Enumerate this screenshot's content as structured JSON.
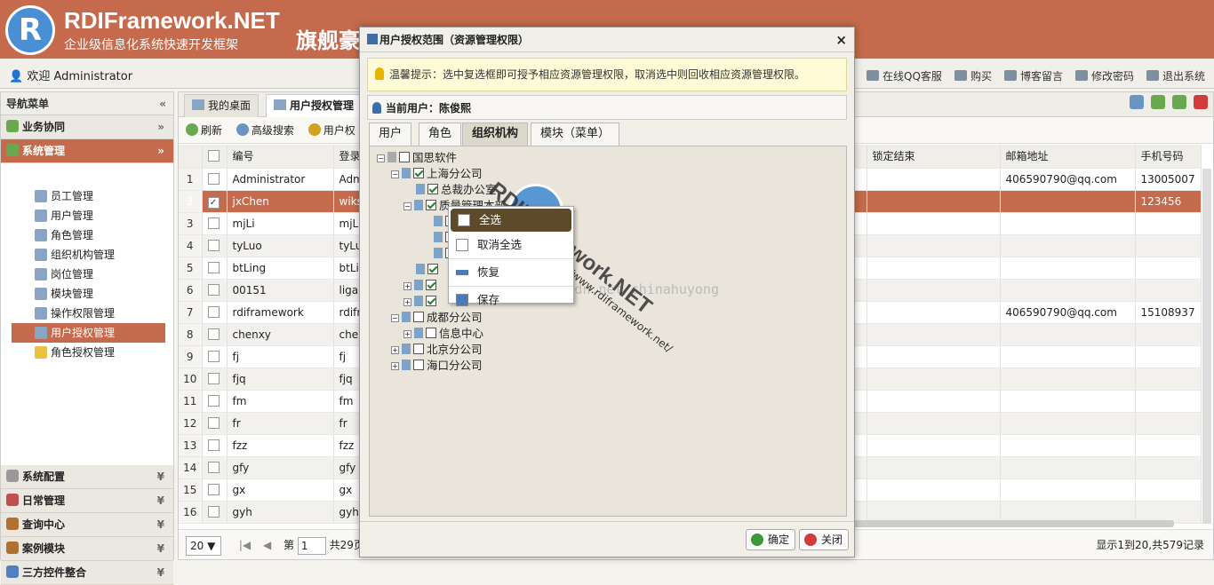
{
  "header": {
    "logo_letter": "R",
    "title": "RDIFramework.NET",
    "subtitle": "企业级信息化系统快速开发框架",
    "edition": "旗舰豪华版"
  },
  "userbar": {
    "welcome": "欢迎 Administrator",
    "links": [
      "在线QQ客服",
      "购买",
      "博客留言",
      "修改密码",
      "退出系统"
    ]
  },
  "nav": {
    "title": "导航菜单",
    "groups": [
      "业务协同",
      "系统管理",
      "系统配置",
      "日常管理",
      "查询中心",
      "案例模块",
      "三方控件整合"
    ],
    "items": [
      "员工管理",
      "用户管理",
      "角色管理",
      "组织机构管理",
      "岗位管理",
      "模块管理",
      "操作权限管理",
      "用户授权管理",
      "角色授权管理"
    ]
  },
  "tabs": [
    "我的桌面",
    "用户授权管理"
  ],
  "toolbar": [
    "刷新",
    "高级搜索",
    "用户权"
  ],
  "grid": {
    "headers": [
      "编号",
      "登录",
      "锁定结束",
      "邮箱地址",
      "手机号码"
    ],
    "rows": [
      {
        "n": "1",
        "code": "Administrator",
        "login": "Adm",
        "lock": "",
        "mail": "406590790@qq.com",
        "phone": "13005007"
      },
      {
        "n": "2",
        "code": "jxChen",
        "login": "wiks",
        "lock": "",
        "mail": "",
        "phone": "123456"
      },
      {
        "n": "3",
        "code": "mjLi",
        "login": "mjLi",
        "lock": "",
        "mail": "",
        "phone": ""
      },
      {
        "n": "4",
        "code": "tyLuo",
        "login": "tyLu",
        "lock": "",
        "mail": "",
        "phone": ""
      },
      {
        "n": "5",
        "code": "btLing",
        "login": "btLi",
        "lock": "",
        "mail": "",
        "phone": ""
      },
      {
        "n": "6",
        "code": "00151",
        "login": "liga",
        "lock": "",
        "mail": "",
        "phone": ""
      },
      {
        "n": "7",
        "code": "rdiframework",
        "login": "rdifr",
        "lock": "",
        "mail": "406590790@qq.com",
        "phone": "15108937"
      },
      {
        "n": "8",
        "code": "chenxy",
        "login": "che",
        "lock": "",
        "mail": "",
        "phone": ""
      },
      {
        "n": "9",
        "code": "fj",
        "login": "fj",
        "lock": "",
        "mail": "",
        "phone": ""
      },
      {
        "n": "10",
        "code": "fjq",
        "login": "fjq",
        "lock": "",
        "mail": "",
        "phone": ""
      },
      {
        "n": "11",
        "code": "fm",
        "login": "fm",
        "lock": "",
        "mail": "",
        "phone": ""
      },
      {
        "n": "12",
        "code": "fr",
        "login": "fr",
        "lock": "",
        "mail": "",
        "phone": ""
      },
      {
        "n": "13",
        "code": "fzz",
        "login": "fzz",
        "lock": "",
        "mail": "",
        "phone": ""
      },
      {
        "n": "14",
        "code": "gfy",
        "login": "gfy",
        "lock": "",
        "mail": "",
        "phone": ""
      },
      {
        "n": "15",
        "code": "gx",
        "login": "gx",
        "lock": "",
        "mail": "",
        "phone": ""
      },
      {
        "n": "16",
        "code": "gyh",
        "login": "gyh",
        "lock": "",
        "mail": "",
        "phone": ""
      }
    ]
  },
  "pager": {
    "page_size": "20 ▼",
    "page_label": "第",
    "page": "1",
    "total_pages": "共29页",
    "info": "显示1到20,共579记录"
  },
  "dialog": {
    "title": "用户授权范围（资源管理权限）",
    "tip": "温馨提示：选中复选框即可授予相应资源管理权限，取消选中则回收相应资源管理权限。",
    "current_user": "当前用户：陈俊熙",
    "tabs": [
      "用户",
      "角色",
      "组织机构",
      "模块（菜单）"
    ],
    "tree": [
      {
        "label": "国思软件"
      },
      {
        "label": "上海分公司"
      },
      {
        "label": "总裁办公室"
      },
      {
        "label": "质量管理本部"
      },
      {
        "label": "成都分公司"
      },
      {
        "label": "信息中心"
      },
      {
        "label": "北京分公司"
      },
      {
        "label": "海口分公司"
      }
    ],
    "context_menu": [
      "全选",
      "取消全选",
      "恢复",
      "保存"
    ],
    "ok": "确定",
    "close": "关闭"
  },
  "watermark": {
    "brand": "RDIFramework.NET",
    "url": "http://www.rdiframework.net/",
    "blog": "http://blog.csdn.net/chinahuyong"
  },
  "colors": {
    "brand": "#c56a4c",
    "blue": "#4a8fd4"
  }
}
